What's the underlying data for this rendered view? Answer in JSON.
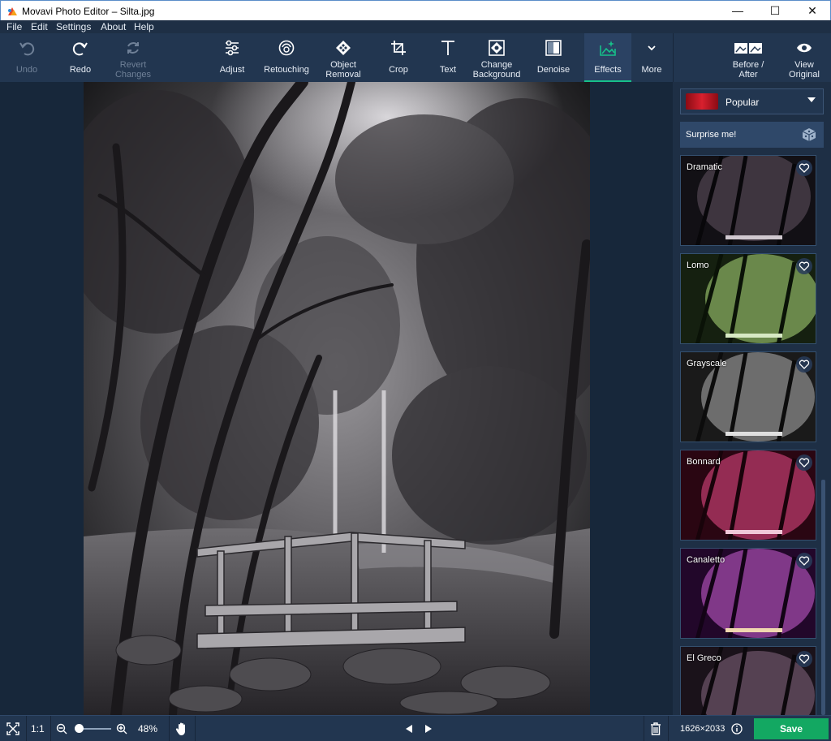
{
  "window": {
    "title": "Movavi Photo Editor – Silta.jpg",
    "controls": {
      "minimize": "—",
      "maximize": "☐",
      "close": "✕"
    }
  },
  "menu": [
    "File",
    "Edit",
    "Settings",
    "About",
    "Help"
  ],
  "toolbar": {
    "undo": "Undo",
    "redo": "Redo",
    "revert_1": "Revert",
    "revert_2": "Changes",
    "adjust": "Adjust",
    "retouching": "Retouching",
    "object_1": "Object",
    "object_2": "Removal",
    "crop": "Crop",
    "text": "Text",
    "change_1": "Change",
    "change_2": "Background",
    "denoise": "Denoise",
    "effects": "Effects",
    "more": "More",
    "before_1": "Before /",
    "before_2": "After",
    "view_1": "View",
    "view_2": "Original",
    "accent": "#17c08a"
  },
  "panel": {
    "category": "Popular",
    "surprise": "Surprise me!",
    "effects": [
      {
        "name": "Dramatic",
        "tint": "#2a2030"
      },
      {
        "name": "Lomo",
        "tint": "#3f6b2a"
      },
      {
        "name": "Grayscale",
        "tint": "#4a4a4a"
      },
      {
        "name": "Bonnard",
        "tint": "#7a1a3a"
      },
      {
        "name": "Canaletto",
        "tint": "#5a1a5e"
      },
      {
        "name": "El Greco",
        "tint": "#3a2a3a"
      }
    ]
  },
  "bottom": {
    "fit": "fit-screen-icon",
    "actual_size": "1:1",
    "zoom": "48%",
    "zoom_level": 0.1,
    "dimensions": "1626×2033",
    "save": "Save"
  }
}
